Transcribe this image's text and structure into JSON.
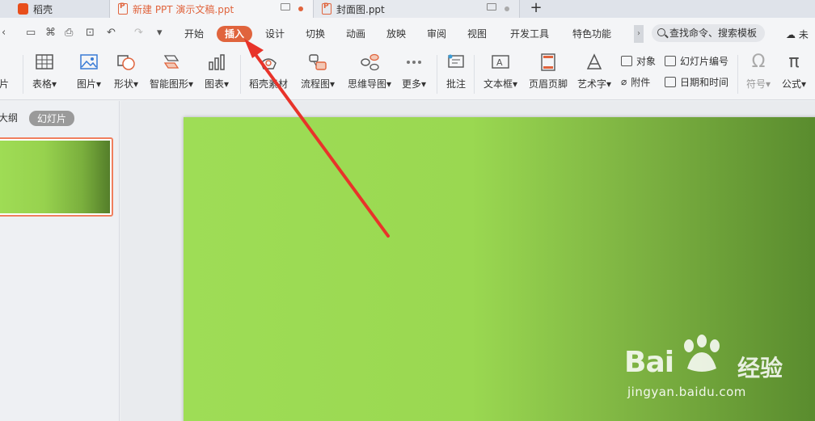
{
  "tabs": [
    {
      "label": "稻壳"
    },
    {
      "label": "新建 PPT 演示文稿.ppt"
    },
    {
      "label": "封面图.ppt"
    }
  ],
  "new_tab_label": "+",
  "menu": [
    "开始",
    "插入",
    "设计",
    "切换",
    "动画",
    "放映",
    "审阅",
    "视图",
    "开发工具",
    "特色功能"
  ],
  "active_menu": "插入",
  "search": {
    "placeholder": "查找命令、搜索模板"
  },
  "cloud_label": "未",
  "ribbon": {
    "left_partial": "片",
    "table": "表格",
    "picture": "图片",
    "shape": "形状",
    "smartart": "智能图形",
    "chart": "图表",
    "material": "稻壳素材",
    "flowchart": "流程图",
    "mindmap": "思维导图",
    "more": "更多",
    "comment": "批注",
    "textbox": "文本框",
    "header_footer": "页眉页脚",
    "wordart": "艺术字",
    "object": "对象",
    "attachment": "附件",
    "slide_number": "幻灯片编号",
    "datetime": "日期和时间",
    "symbol": "符号",
    "formula": "公式"
  },
  "left_pane": {
    "outline": "大纲",
    "slides": "幻灯片"
  },
  "watermark": {
    "brand": "Bai",
    "brand2": "经验",
    "url": "jingyan.baidu.com"
  },
  "colors": {
    "accent": "#e0643d",
    "slide_green_light": "#9edd56",
    "slide_green_dark": "#588a2d",
    "arrow": "#e8332a"
  }
}
